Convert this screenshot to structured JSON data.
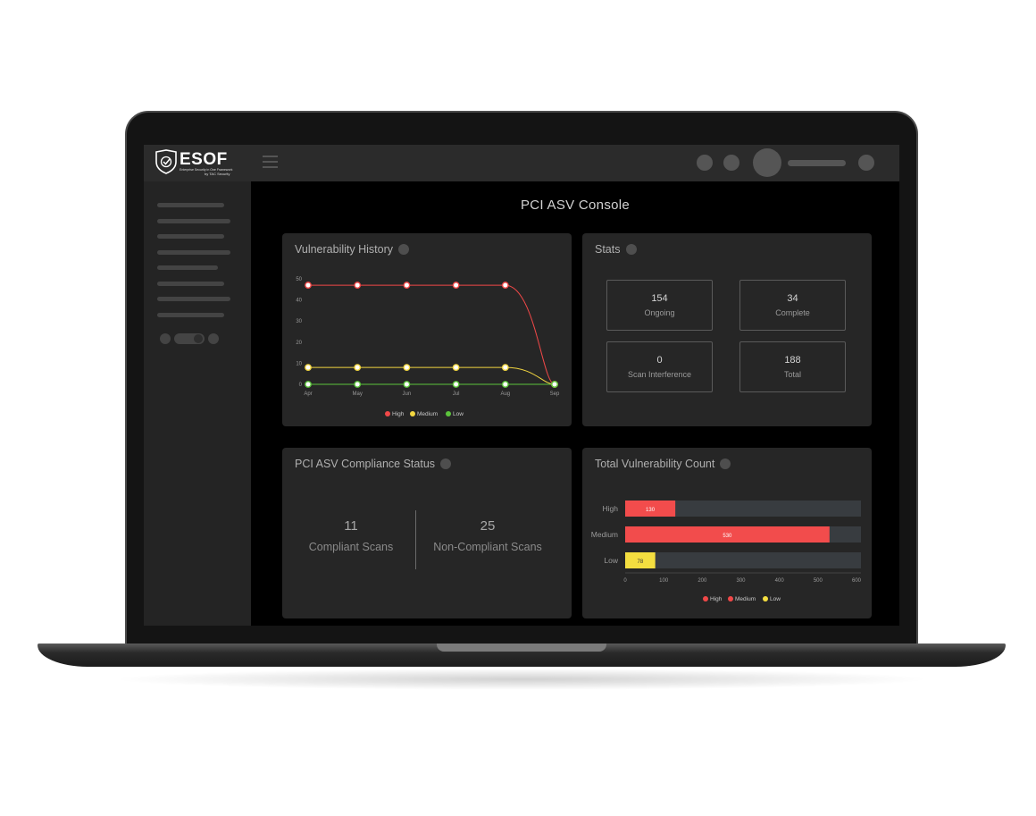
{
  "app": {
    "logo_text": "ESOF",
    "logo_subtitle": "Enterprise Security in One Framework",
    "logo_by": "by TAC Security",
    "page_title": "PCI ASV Console"
  },
  "icons": {
    "logo": "shield-check-icon",
    "menu": "hamburger-menu-icon",
    "info": "info-dot-icon"
  },
  "colors": {
    "high": "#f04848",
    "medium": "#f2d640",
    "low": "#5cc43c",
    "high_bar": "#f24c4c",
    "low_bar": "#f4de40"
  },
  "cards": {
    "history": {
      "title": "Vulnerability History"
    },
    "stats": {
      "title": "Stats"
    },
    "compliance": {
      "title": "PCI ASV Compliance Status"
    },
    "total": {
      "title": "Total Vulnerability Count"
    }
  },
  "stats": [
    {
      "value": "154",
      "label": "Ongoing"
    },
    {
      "value": "34",
      "label": "Complete"
    },
    {
      "value": "0",
      "label": "Scan Interference"
    },
    {
      "value": "188",
      "label": "Total"
    }
  ],
  "compliance": {
    "compliant_value": "11",
    "compliant_label": "Compliant Scans",
    "noncompliant_value": "25",
    "noncompliant_label": "Non-Compliant Scans"
  },
  "chart_data": [
    {
      "type": "line",
      "title": "Vulnerability History",
      "x": [
        "Apr",
        "May",
        "Jun",
        "Jul",
        "Aug",
        "Sep"
      ],
      "ylim": [
        0,
        50
      ],
      "yticks": [
        0,
        10,
        20,
        30,
        40,
        50
      ],
      "grid": false,
      "legend": "bottom",
      "series": [
        {
          "name": "High",
          "values": [
            47,
            47,
            47,
            47,
            47,
            0
          ]
        },
        {
          "name": "Medium",
          "values": [
            8,
            8,
            8,
            8,
            8,
            0
          ]
        },
        {
          "name": "Low",
          "values": [
            0,
            0,
            0,
            0,
            0,
            0
          ]
        }
      ]
    },
    {
      "type": "bar",
      "orientation": "horizontal",
      "title": "Total Vulnerability Count",
      "categories": [
        "High",
        "Medium",
        "Low"
      ],
      "values": [
        130,
        530,
        78
      ],
      "value_labels": [
        "130",
        "530",
        "78"
      ],
      "xlim": [
        0,
        600
      ],
      "xticks": [
        0,
        100,
        200,
        300,
        400,
        500,
        600
      ],
      "legend": "bottom",
      "legend_entries": [
        "High",
        "Medium",
        "Low"
      ]
    }
  ]
}
